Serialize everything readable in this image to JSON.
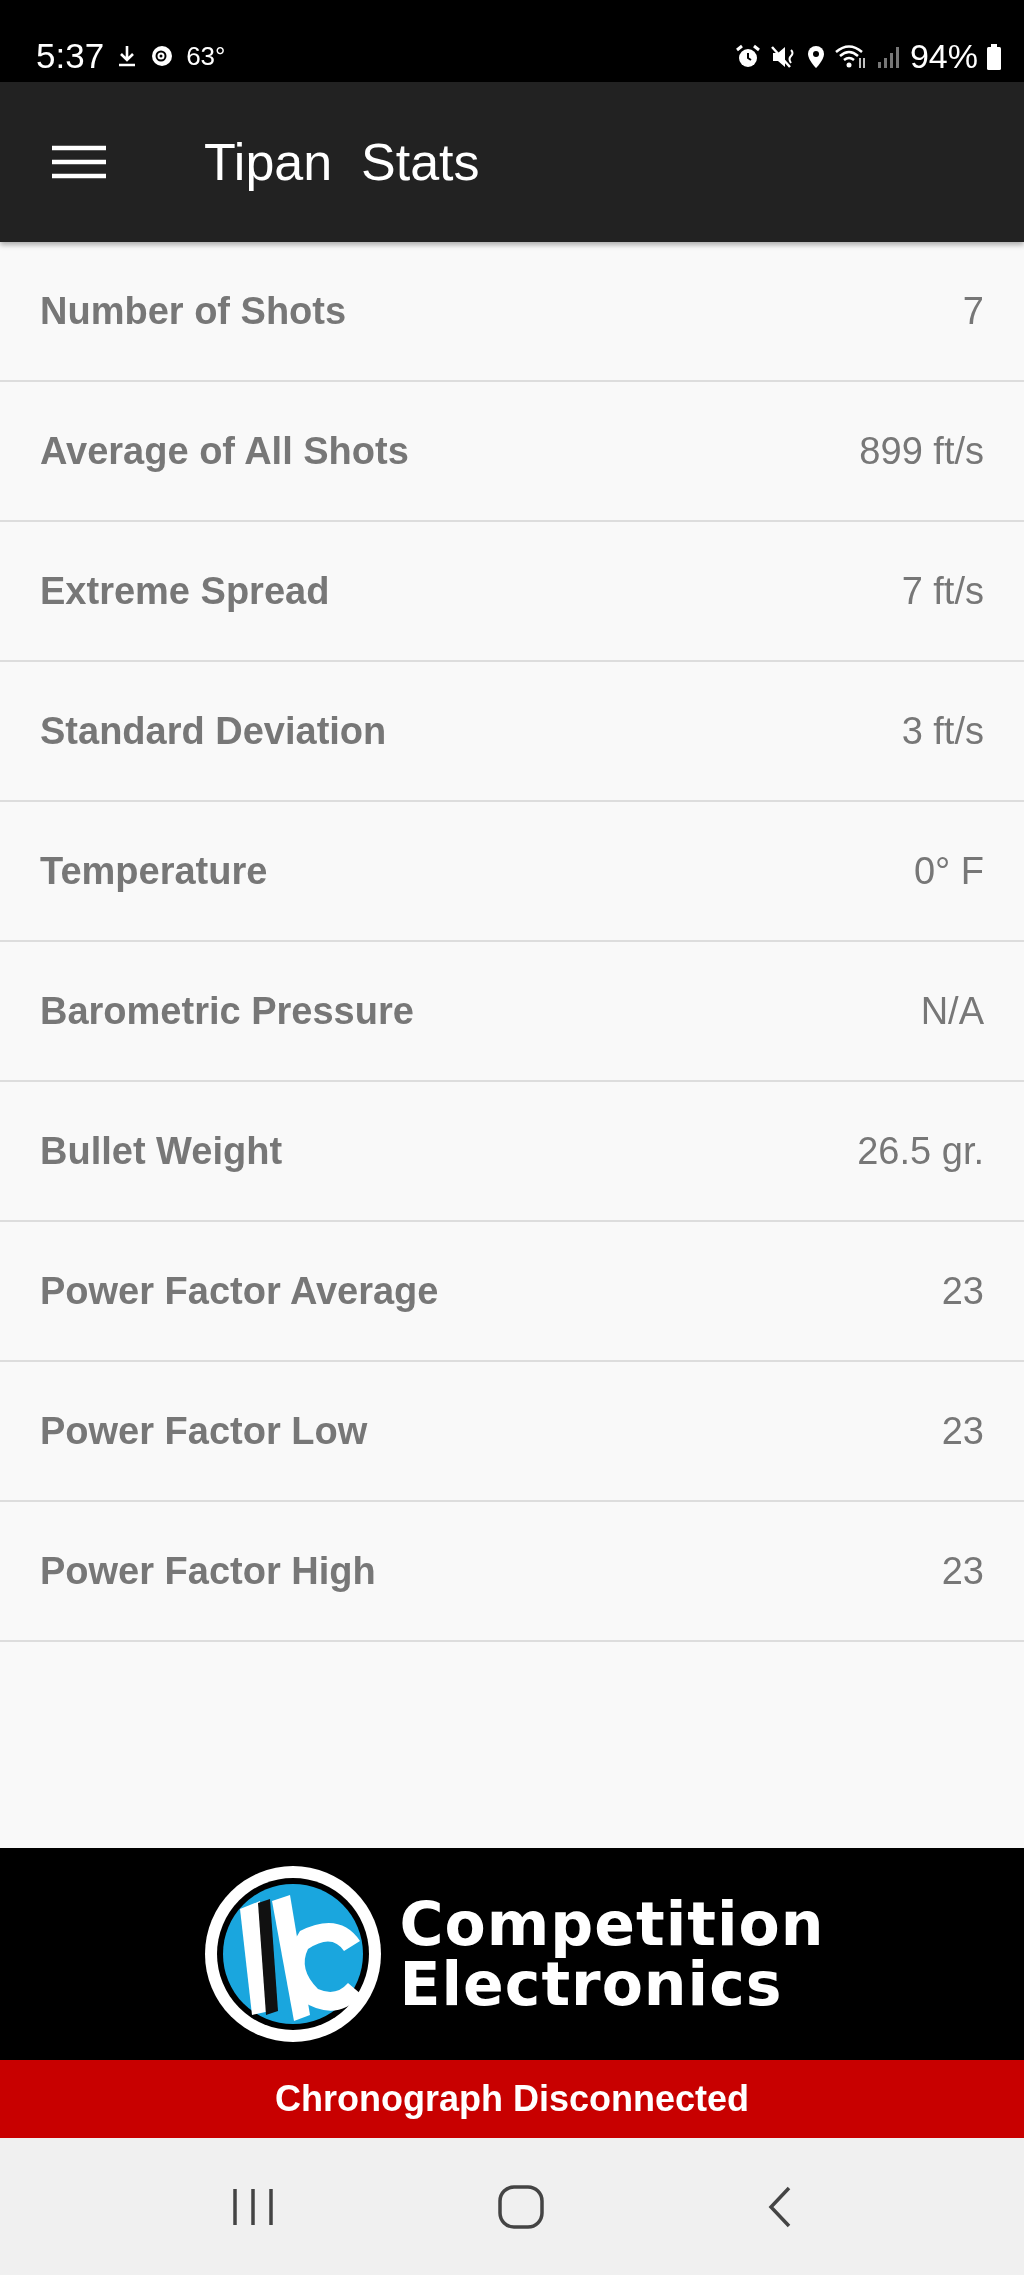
{
  "status_bar": {
    "time": "5:37",
    "temperature": "63°",
    "battery": "94%"
  },
  "app_bar": {
    "title": "Tipan  Stats"
  },
  "stats": [
    {
      "label": "Number of Shots",
      "value": "7"
    },
    {
      "label": "Average of All Shots",
      "value": "899 ft/s"
    },
    {
      "label": "Extreme Spread",
      "value": "7 ft/s"
    },
    {
      "label": "Standard Deviation",
      "value": "3 ft/s"
    },
    {
      "label": "Temperature",
      "value": "0° F"
    },
    {
      "label": "Barometric Pressure",
      "value": "N/A"
    },
    {
      "label": "Bullet Weight",
      "value": "26.5 gr."
    },
    {
      "label": "Power Factor Average",
      "value": "23"
    },
    {
      "label": "Power Factor Low",
      "value": "23"
    },
    {
      "label": "Power Factor High",
      "value": "23"
    }
  ],
  "brand": {
    "line_1": "Competition",
    "line_2": "Electronics"
  },
  "connection_banner": {
    "text": "Chronograph Disconnected"
  }
}
